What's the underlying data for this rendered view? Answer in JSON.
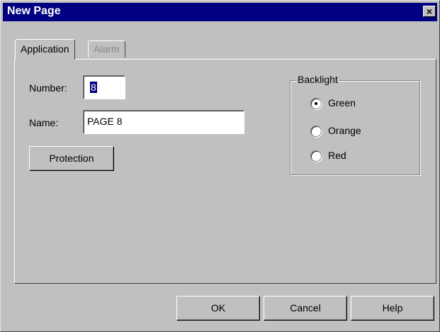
{
  "window": {
    "title": "New Page",
    "close_symbol": "×"
  },
  "tabs": [
    {
      "label": "Application",
      "active": true
    },
    {
      "label": "Alarm",
      "active": false,
      "disabled": true
    }
  ],
  "form": {
    "number_label": "Number:",
    "number_value": "8",
    "name_label": "Name:",
    "name_value": "PAGE 8",
    "protection_button": "Protection"
  },
  "backlight": {
    "label": "Backlight",
    "options": [
      {
        "label": "Green",
        "selected": true
      },
      {
        "label": "Orange",
        "selected": false
      },
      {
        "label": "Red",
        "selected": false
      }
    ]
  },
  "buttons": {
    "ok": "OK",
    "cancel": "Cancel",
    "help": "Help"
  },
  "colors": {
    "titlebar": "#000080",
    "face": "#c0c0c0",
    "disabled_text": "#8a8a8a"
  }
}
